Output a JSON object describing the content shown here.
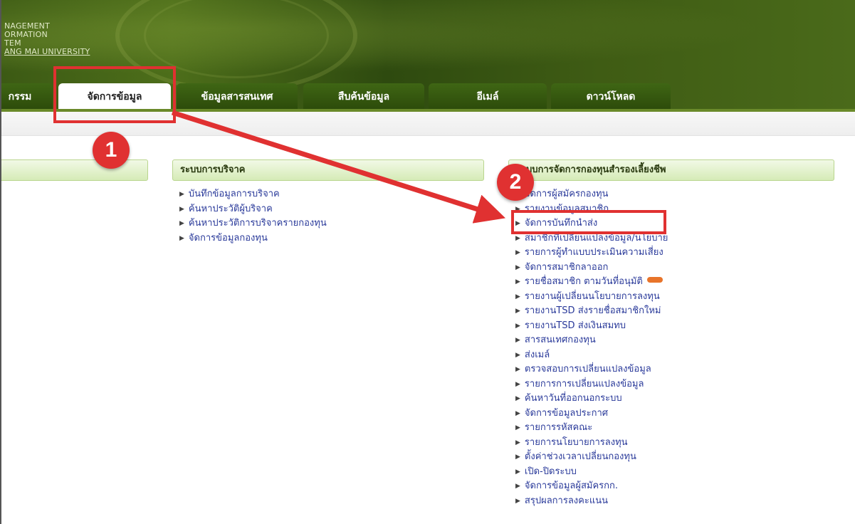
{
  "brand": {
    "lines": [
      "NAGEMENT",
      "ORMATION",
      "TEM",
      "ANG MAI UNIVERSITY"
    ]
  },
  "tabs": [
    {
      "label": "กรรม",
      "active": false
    },
    {
      "label": "จัดการข้อมูล",
      "active": true
    },
    {
      "label": "ข้อมูลสารสนเทศ",
      "active": false
    },
    {
      "label": "สืบค้นข้อมูล",
      "active": false
    },
    {
      "label": "อีเมล์",
      "active": false
    },
    {
      "label": "ดาวน์โหลด",
      "active": false
    }
  ],
  "donation": {
    "title": "ระบบการบริจาค",
    "items": [
      "บันทึกข้อมูลการบริจาค",
      "ค้นหาประวัติผู้บริจาค",
      "ค้นหาประวัติการบริจาครายกองทุน",
      "จัดการข้อมูลกองทุน"
    ]
  },
  "pvd": {
    "title": "ระบบการจัดการกองทุนสำรองเลี้ยงชีพ",
    "items": [
      "จัดการผู้สมัครกองทุน",
      "รายงานข้อมูลสมาชิก",
      "จัดการบันทึกนำส่ง",
      "สมาชิกที่เปลี่ยนแปลงข้อมูล/นโยบาย",
      "รายการผู้ทำแบบประเมินความเสี่ยง",
      "จัดการสมาชิกลาออก",
      "รายชื่อสมาชิก ตามวันที่อนุมัติ",
      "รายงานผู้เปลี่ยนนโยบายการลงทุน",
      "รายงานTSD ส่งรายชื่อสมาชิกใหม่",
      "รายงานTSD ส่งเงินสมทบ",
      "สารสนเทศกองทุน",
      "ส่งเมล์",
      "ตรวจสอบการเปลี่ยนแปลงข้อมูล",
      "รายการการเปลี่ยนแปลงข้อมูล",
      "ค้นหาวันที่ออกนอกระบบ",
      "จัดการข้อมูลประกาศ",
      "รายการรหัสคณะ",
      "รายการนโยบายการลงทุน",
      "ตั้งค่าช่วงเวลาเปลี่ยนกองทุน",
      "เปิด-ปิดระบบ",
      "จัดการข้อมูลผู้สมัครกก.",
      "สรุปผลการลงคะแนน"
    ]
  },
  "annotations": {
    "step1": "1",
    "step2": "2",
    "color": "#e03131"
  }
}
